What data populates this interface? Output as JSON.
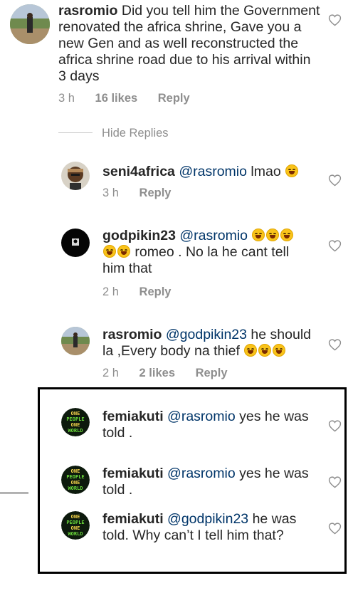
{
  "comments": [
    {
      "id": "c1",
      "username": "rasromio",
      "mention": "",
      "text": "Did you tell him the Government renovated the africa shrine, Gave you a new Gen and as well reconstructed the africa shrine road due to  his arrival within 3 days",
      "time": "3 h",
      "likes": "16 likes",
      "reply": "Reply"
    },
    {
      "id": "c2",
      "username": "seni4africa",
      "mention": "@rasromio",
      "text": "lmao",
      "time": "3 h",
      "likes": "",
      "reply": "Reply"
    },
    {
      "id": "c3",
      "username": "godpikin23",
      "mention": "@rasromio",
      "text": "romeo . No la he cant tell him that",
      "time": "2 h",
      "likes": "",
      "reply": "Reply"
    },
    {
      "id": "c4",
      "username": "rasromio",
      "mention": "@godpikin23",
      "text": "he should la ,Every body na thief",
      "time": "2 h",
      "likes": "2 likes",
      "reply": "Reply"
    },
    {
      "id": "c5",
      "username": "femiakuti",
      "mention": "@rasromio",
      "text": "yes he was told .",
      "avatar_text": [
        "ONE",
        "PEOPLE",
        "ONE",
        "WORLD"
      ]
    },
    {
      "id": "c6",
      "username": "femiakuti",
      "mention": "@rasromio",
      "text": "yes he was told ."
    },
    {
      "id": "c7",
      "username": "femiakuti",
      "mention": "@godpikin23",
      "text": "he was told. Why can’t I tell him that?"
    }
  ],
  "hide_replies": "Hide Replies",
  "icons": {
    "like": "heart-outline-icon"
  },
  "colors": {
    "text": "#262626",
    "meta": "#8e8e8e",
    "mention": "#003569",
    "highlight_border": "#000000"
  }
}
